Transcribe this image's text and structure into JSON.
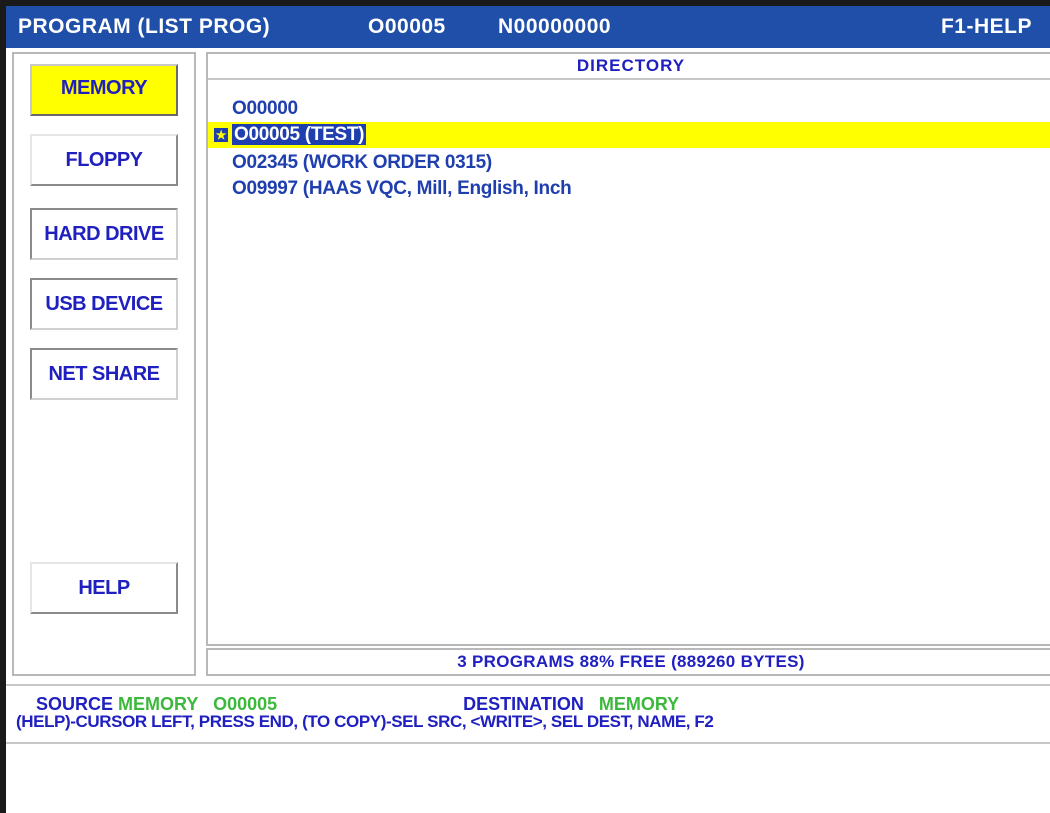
{
  "titlebar": {
    "mode": "PROGRAM  (LIST PROG)",
    "program": "O00005",
    "sequence": "N00000000",
    "help_hint": "F1-HELP"
  },
  "devices": [
    {
      "label": "MEMORY",
      "active": true
    },
    {
      "label": "FLOPPY",
      "active": false
    },
    {
      "label": "HARD DRIVE",
      "active": false
    },
    {
      "label": "USB DEVICE",
      "active": false
    },
    {
      "label": "NET SHARE",
      "active": false
    }
  ],
  "help_button": "HELP",
  "directory": {
    "title": "DIRECTORY",
    "programs": [
      {
        "text": "O00000",
        "selected": false
      },
      {
        "text": "O00005 (TEST)",
        "selected": true,
        "star_icon": "star-icon"
      },
      {
        "text": "O02345 (WORK ORDER 0315)",
        "selected": false
      },
      {
        "text": "O09997 (HAAS VQC, Mill, English, Inch",
        "selected": false
      }
    ],
    "free_space": "3 PROGRAMS 88% FREE (889260 BYTES)"
  },
  "status": {
    "source_label": "SOURCE",
    "source_value": "MEMORY",
    "source_program": "O00005",
    "destination_label": "DESTINATION",
    "destination_value": "MEMORY",
    "help_text": "(HELP)-CURSOR LEFT, PRESS END,  (TO COPY)-SEL SRC, <WRITE>, SEL DEST, NAME, F2"
  },
  "colors": {
    "titlebar_bg": "#1f4fa8",
    "text_blue": "#2020c0",
    "highlight_yellow": "#ffff00",
    "status_green": "#3cb83c"
  }
}
